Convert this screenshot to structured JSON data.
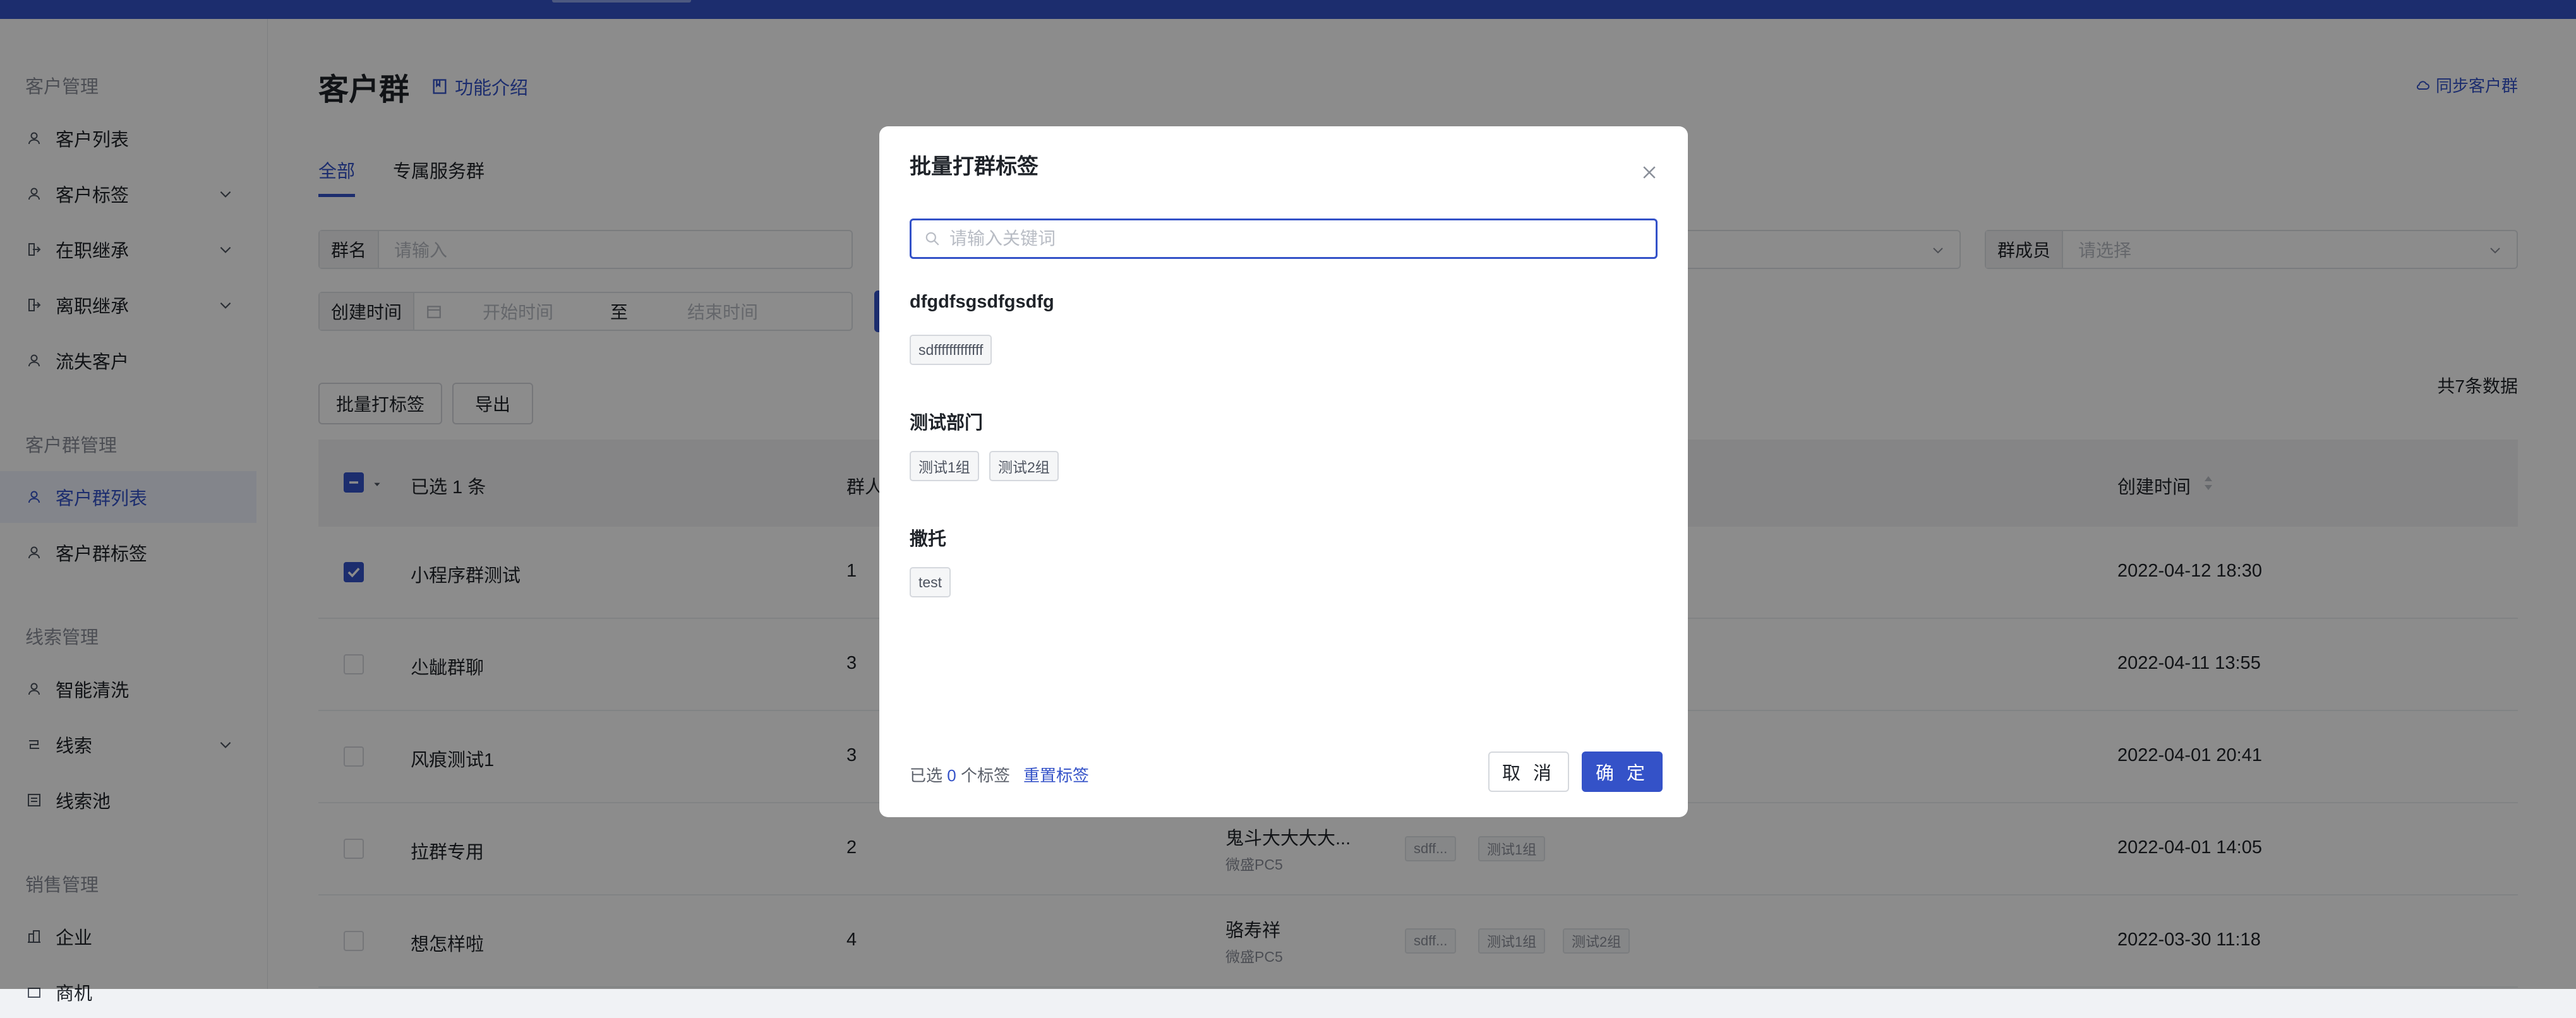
{
  "sidebar": {
    "groups": [
      {
        "label": "客户管理",
        "items": [
          {
            "label": "客户列表",
            "icon": "user-icon",
            "expandable": false
          },
          {
            "label": "客户标签",
            "icon": "user-icon",
            "expandable": true
          },
          {
            "label": "在职继承",
            "icon": "login-icon",
            "expandable": true
          },
          {
            "label": "离职继承",
            "icon": "logout-icon",
            "expandable": true
          },
          {
            "label": "流失客户",
            "icon": "user-icon",
            "expandable": false
          }
        ]
      },
      {
        "label": "客户群管理",
        "items": [
          {
            "label": "客户群列表",
            "icon": "user-icon",
            "active": true
          },
          {
            "label": "客户群标签",
            "icon": "user-icon"
          }
        ]
      },
      {
        "label": "线索管理",
        "items": [
          {
            "label": "智能清洗",
            "icon": "user-icon"
          },
          {
            "label": "线索",
            "icon": "flow-icon",
            "expandable": true
          },
          {
            "label": "线索池",
            "icon": "pool-icon"
          }
        ]
      },
      {
        "label": "销售管理",
        "items": [
          {
            "label": "企业",
            "icon": "building-icon"
          },
          {
            "label": "商机",
            "icon": "box-icon"
          }
        ]
      }
    ]
  },
  "header": {
    "title": "客户群",
    "feature_link": "功能介绍",
    "sync_link": "同步客户群"
  },
  "tabs": [
    {
      "label": "全部",
      "active": true
    },
    {
      "label": "专属服务群",
      "active": false
    }
  ],
  "filters": {
    "group_name_label": "群名",
    "group_name_placeholder": "请输入",
    "create_time_label": "创建时间",
    "start_placeholder": "开始时间",
    "range_sep": "至",
    "end_placeholder": "结束时间",
    "member_label": "群成员",
    "member_placeholder": "请选择"
  },
  "toolbar": {
    "batch_tag": "批量打标签",
    "export": "导出",
    "total": "共7条数据"
  },
  "table": {
    "selected_label": "已选 1 条",
    "col_count": "群人数",
    "col_created": "创建时间",
    "rows": [
      {
        "name": "小程序群测试",
        "count": "1",
        "owner": "",
        "owner_sub": "",
        "tags": [],
        "created": "2022-04-12 18:30",
        "checked": true
      },
      {
        "name": "尐龇群聊",
        "count": "3",
        "owner": "",
        "owner_sub": "",
        "tags": [],
        "created": "2022-04-11 13:55",
        "checked": false
      },
      {
        "name": "风痕测试1",
        "count": "3",
        "owner": "",
        "owner_sub": "",
        "tags": [],
        "created": "2022-04-01 20:41",
        "checked": false
      },
      {
        "name": "拉群专用",
        "count": "2",
        "owner": "鬼斗大大大大...",
        "owner_sub": "微盛PC5",
        "tags": [
          "sdff...",
          "测试1组"
        ],
        "created": "2022-04-01 14:05",
        "checked": false
      },
      {
        "name": "想怎样啦",
        "count": "4",
        "owner": "骆寿祥",
        "owner_sub": "微盛PC5",
        "tags": [
          "sdff...",
          "测试1组",
          "测试2组"
        ],
        "created": "2022-03-30 11:18",
        "checked": false
      }
    ]
  },
  "modal": {
    "title": "批量打群标签",
    "search_placeholder": "请输入关键词",
    "groups": [
      {
        "title": "dfgdfsgsdfgsdfg",
        "tags": [
          "sdfffffffffffff"
        ]
      },
      {
        "title": "测试部门",
        "tags": [
          "测试1组",
          "测试2组"
        ]
      },
      {
        "title": "撒托",
        "tags": [
          "test"
        ]
      }
    ],
    "selected_prefix": "已选",
    "selected_count": "0",
    "selected_suffix": "个标签",
    "reset_label": "重置标签",
    "cancel_label": "取 消",
    "ok_label": "确 定"
  },
  "colors": {
    "primary": "#3452c8",
    "overlay": "rgba(0,0,0,0.45)"
  }
}
